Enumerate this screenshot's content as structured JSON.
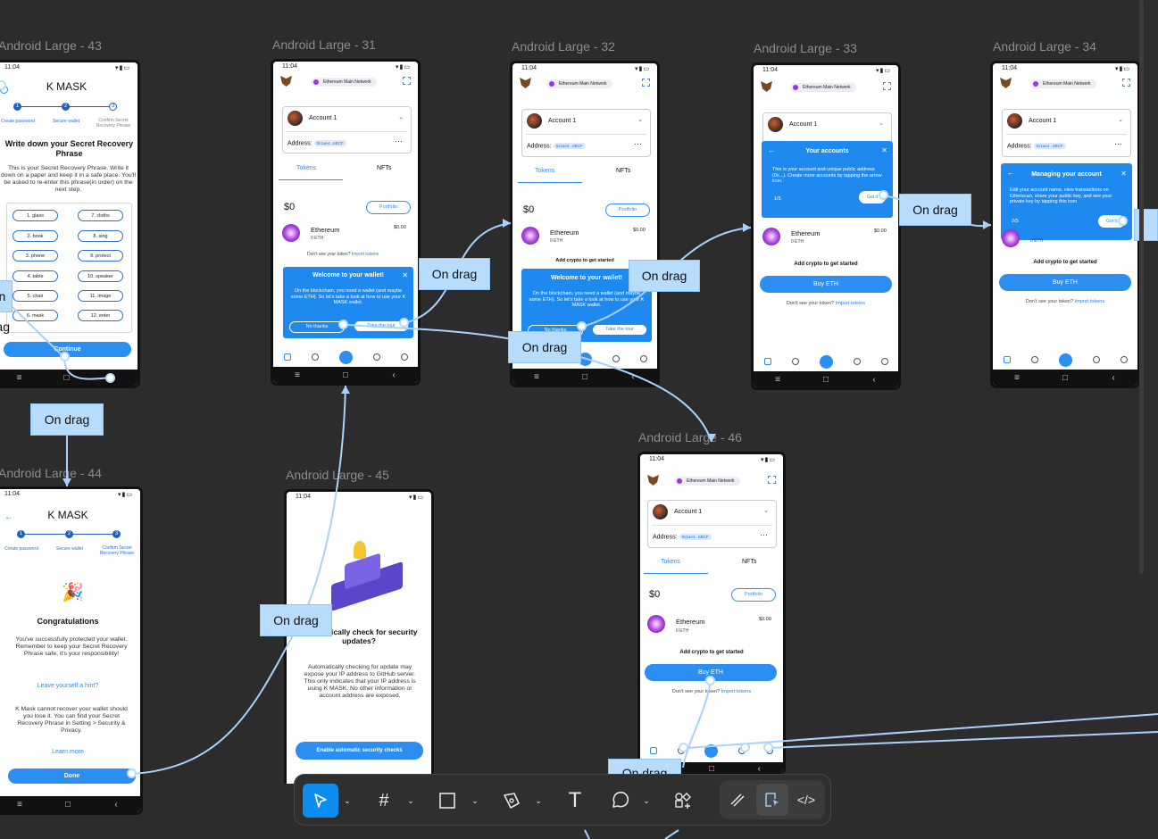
{
  "frames": {
    "f43": {
      "label": "Android Large - 43"
    },
    "f31": {
      "label": "Android Large - 31"
    },
    "f32": {
      "label": "Android Large - 32"
    },
    "f33": {
      "label": "Android Large - 33"
    },
    "f34": {
      "label": "Android Large - 34"
    },
    "f44": {
      "label": "Android Large - 44"
    },
    "f45": {
      "label": "Android Large - 45"
    },
    "f46": {
      "label": "Android Large - 46"
    }
  },
  "status_time": "11:04",
  "app_name": "K MASK",
  "steps": [
    "Create password",
    "Secure wallet",
    "Confirm Secret Recovery Phrase"
  ],
  "s43": {
    "heading": "Write down your Secret Recovery Phrase",
    "body": "This is your Secret Recovery Phrase. Write it down on a paper and keep it in a safe place. You'll be asked to re-enter this phrase(in order) on the next step.",
    "words": [
      "1. glass",
      "7. cloths",
      "2. book",
      "8. sing",
      "3. phone",
      "9. protect",
      "4. table",
      "10. speaker",
      "5. chair",
      "11. image",
      "6. mask",
      "12. enter"
    ],
    "continue": "Continue"
  },
  "wallet": {
    "network": "Ethereum Main Network",
    "account": "Account 1",
    "address_label": "Address:",
    "address": "0x1ae4...6BCF",
    "tab_tokens": "Tokens",
    "tab_nfts": "NFTs",
    "balance": "$0",
    "portfolio": "Portfolio",
    "token_name": "Ethereum",
    "token_amount": "0 ETH",
    "token_value": "$0.00",
    "dont_see": "Don't see your token?",
    "import": "Import tokens",
    "add_crypto": "Add crypto to get started",
    "buy": "Buy ETH"
  },
  "welcome": {
    "title": "Welcome to your wallet!",
    "body": "On the blockchain, you need a wallet (and maybe some ETH). So let's take a look at how to use your K MASK wallet.",
    "no": "No thanks",
    "take": "Take the tour"
  },
  "tour33": {
    "title": "Your accounts",
    "body": "This is your account and unique public address (0x...). Create more accounts by tapping the arrow icon.",
    "page": "1/5",
    "got": "Got it"
  },
  "tour34": {
    "title": "Managing your account",
    "body": "Edit your account name, view transactions on Etherscan, share your public key, and see your private key by tapping this icon",
    "page": "2/5",
    "got": "Got it"
  },
  "s44": {
    "heading": "Congratulations",
    "body": "You've successfully protected your wallet. Remember to keep your Secret Recovery Phrase safe, it's your responsibility!",
    "hint": "Leave yourself a hint?",
    "body2": "K Mask cannot recover your wallet should you lose it. You can find your Secret Recovery Phrase in Setting > Security & Privacy.",
    "learn": "Learn more",
    "done": "Done"
  },
  "s45": {
    "heading": "Automatically check for security updates?",
    "body": "Automatically checking for update may expose your IP address to GitHub server. This only indicates that your IP address is using K MASK. No other information or account address are exposed.",
    "enable": "Enable automatic security checks"
  },
  "interaction_label": "On drag",
  "toolbar": {
    "tools": [
      "move-tool",
      "frame-tool",
      "rectangle-tool",
      "pen-tool",
      "text-tool",
      "comment-tool",
      "actions-tool"
    ],
    "modes": [
      "draw-mode",
      "design-mode",
      "dev-mode"
    ]
  }
}
